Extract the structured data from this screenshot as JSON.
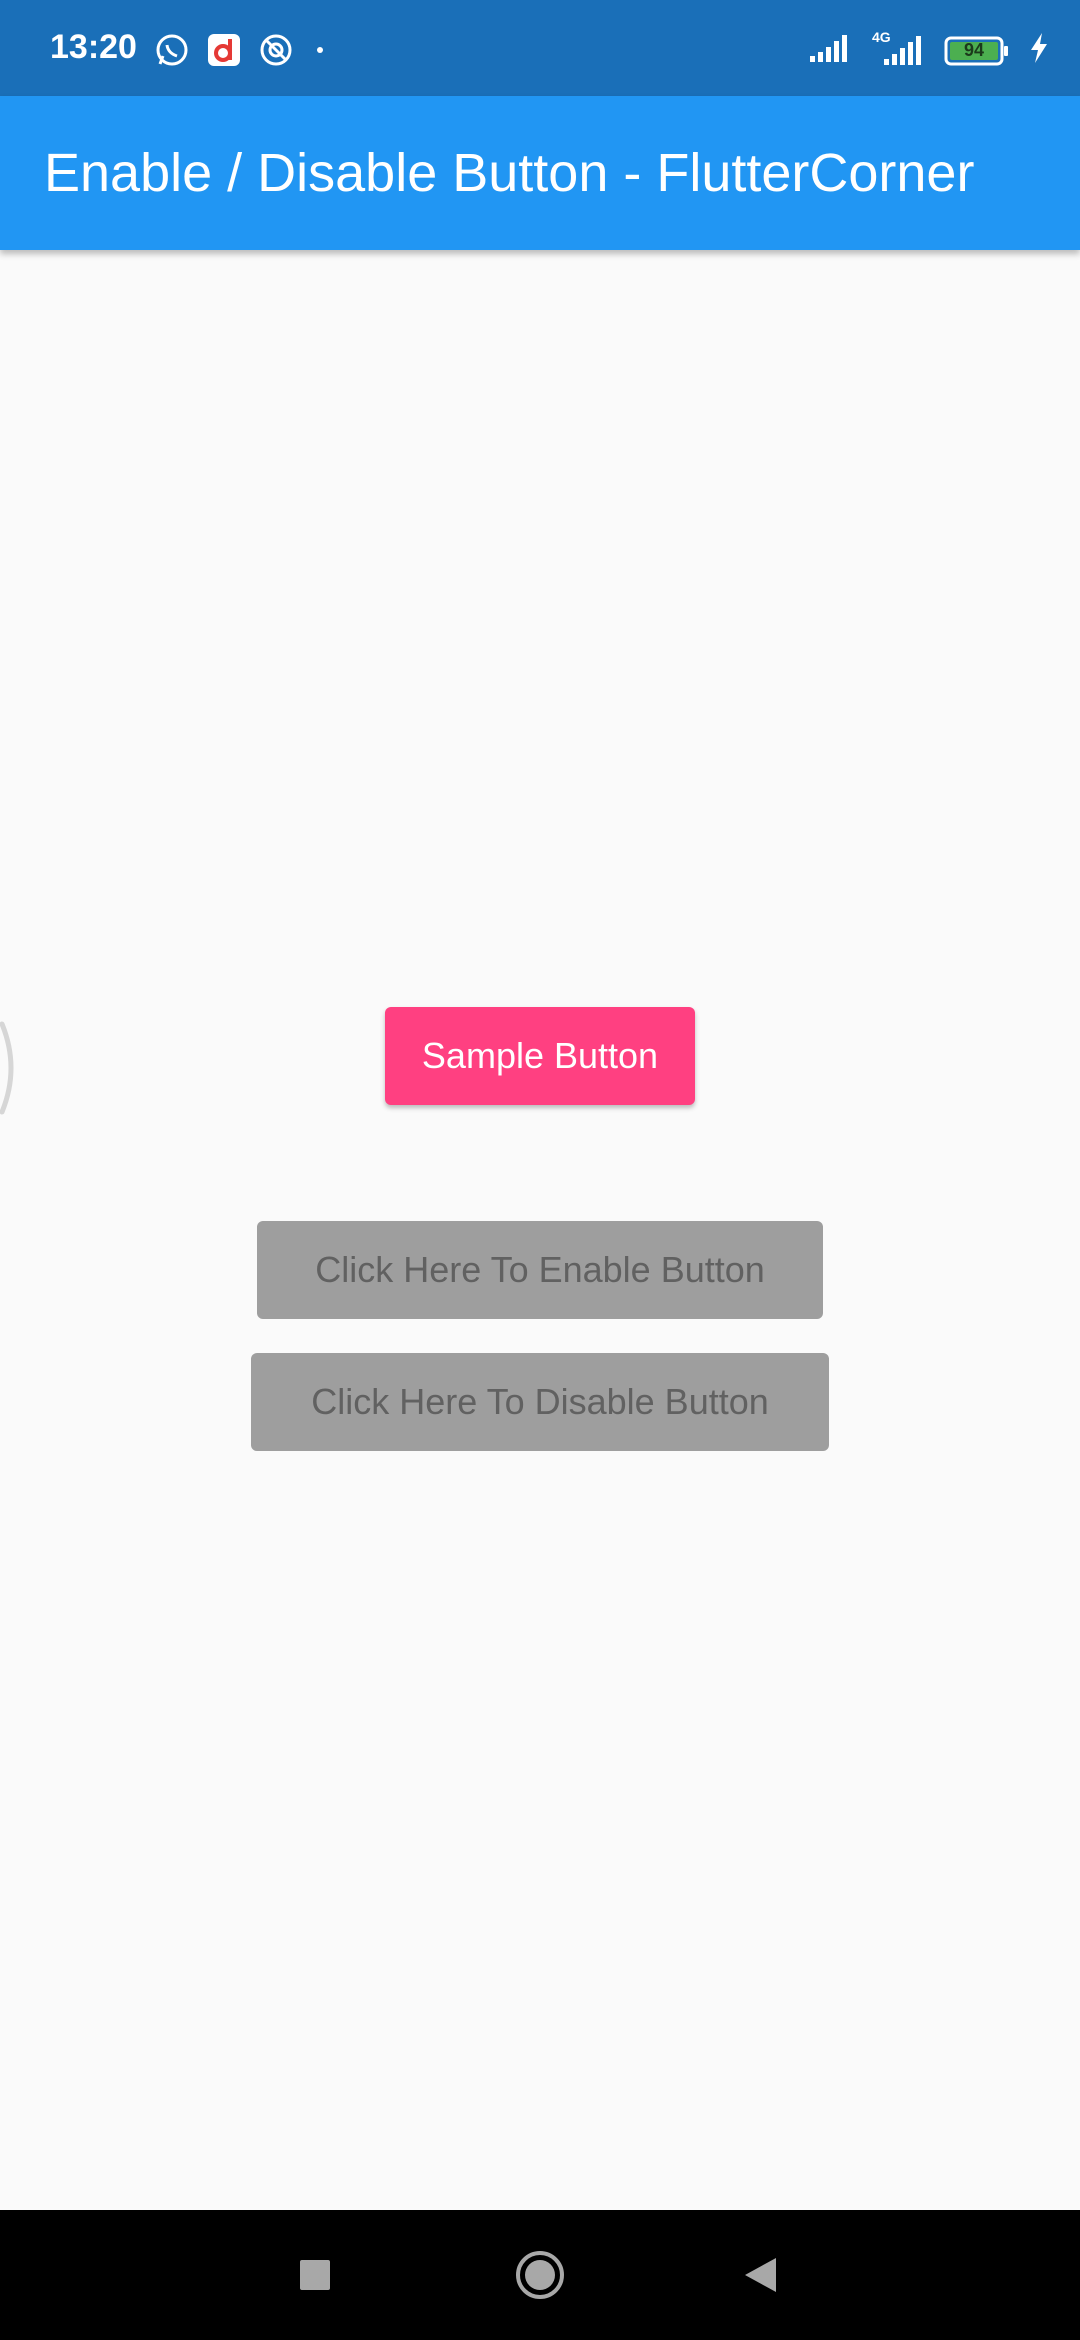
{
  "status_bar": {
    "time": "13:20",
    "left_icons": [
      "whatsapp-icon",
      "dailyhunt-icon",
      "do-not-disturb-app-icon",
      "dot-icon"
    ],
    "network_label": "4G",
    "battery_level": "94",
    "charging": true,
    "color": "#1a6fb8"
  },
  "app_bar": {
    "title": "Enable / Disable Button - FlutterCorner",
    "color": "#2196f3"
  },
  "buttons": {
    "sample": {
      "label": "Sample Button",
      "color": "#ff4081"
    },
    "enable": {
      "label": "Click Here To Enable Button",
      "color": "#9e9e9e"
    },
    "disable": {
      "label": "Click Here To Disable Button",
      "color": "#9e9e9e"
    }
  },
  "nav_bar": {
    "items": [
      "recents-square-icon",
      "home-circle-icon",
      "back-triangle-icon"
    ]
  }
}
